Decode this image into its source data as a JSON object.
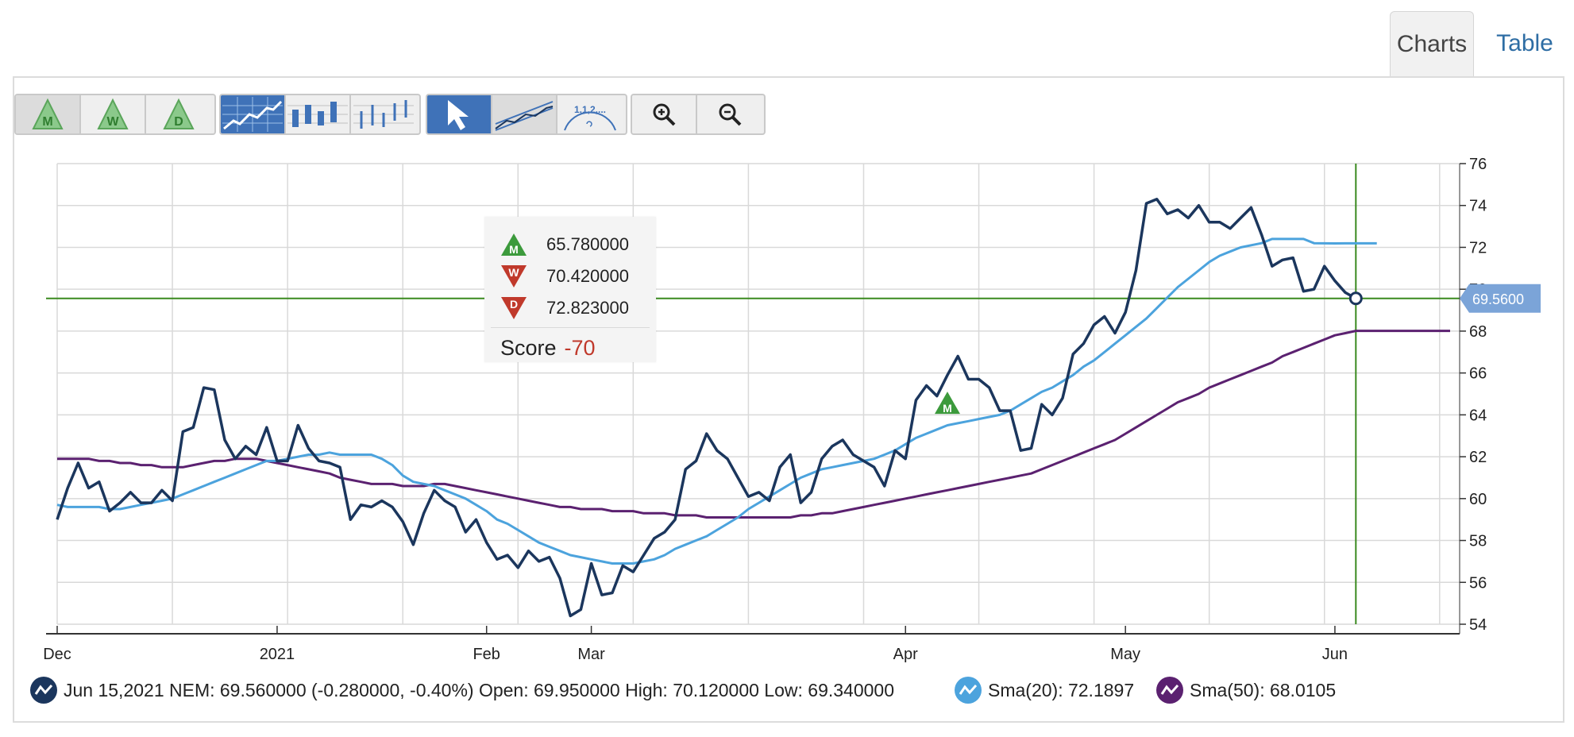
{
  "tabs": [
    {
      "label": "Charts",
      "active": true
    },
    {
      "label": "Table",
      "active": false
    }
  ],
  "toolbar": {
    "signal_buttons": [
      "M",
      "W",
      "D"
    ],
    "chart_type_buttons": [
      "line-chart-icon",
      "candlestick-chart-icon",
      "ohlc-chart-icon"
    ],
    "drawing_buttons": [
      "pointer-icon",
      "trend-channel-icon",
      "fibonacci-icon"
    ],
    "fibonacci_text": "1,1,2,...",
    "zoom_buttons": [
      "zoom-in-icon",
      "zoom-out-icon"
    ]
  },
  "tooltip": {
    "rows": [
      {
        "signal": "M",
        "direction": "up",
        "value": "65.780000"
      },
      {
        "signal": "W",
        "direction": "down",
        "value": "70.420000"
      },
      {
        "signal": "D",
        "direction": "down",
        "value": "72.823000"
      }
    ],
    "score_label": "Score",
    "score_value": "-70"
  },
  "legend": {
    "price_text": "Jun 15,2021 NEM: 69.560000 (-0.280000, -0.40%) Open: 69.950000 High: 70.120000 Low: 69.340000",
    "sma20_text": "Sma(20): 72.1897",
    "sma50_text": "Sma(50): 68.0105"
  },
  "colors": {
    "price": "#1b365d",
    "sma20": "#4ca3dd",
    "sma50": "#5b2170",
    "green_line": "#3a8a1f",
    "price_tag": "#7ba4d8",
    "signal_up": "#3c9a3c",
    "signal_down": "#c0392b"
  },
  "chart_data": {
    "type": "line",
    "ylim": [
      54,
      76
    ],
    "yticks": [
      54,
      56,
      58,
      60,
      62,
      64,
      66,
      68,
      70,
      72,
      74,
      76
    ],
    "xlim": [
      0,
      133
    ],
    "xticks": [
      {
        "x": 0,
        "label": "Dec"
      },
      {
        "x": 21,
        "label": "2021"
      },
      {
        "x": 41,
        "label": "Feb"
      },
      {
        "x": 51,
        "label": "Mar"
      },
      {
        "x": 81,
        "label": "Apr"
      },
      {
        "x": 102,
        "label": "May"
      },
      {
        "x": 122,
        "label": "Jun"
      }
    ],
    "current_value": 69.56,
    "current_value_label": "69.5600",
    "signal_marker": {
      "x": 85,
      "y": 64.5,
      "label": "M",
      "direction": "up"
    },
    "series": [
      {
        "name": "NEM",
        "values": [
          59.0,
          60.5,
          61.7,
          60.5,
          60.8,
          59.4,
          59.8,
          60.3,
          59.8,
          59.8,
          60.4,
          59.9,
          63.2,
          63.4,
          65.3,
          65.2,
          62.8,
          61.9,
          62.5,
          62.1,
          63.4,
          61.8,
          61.8,
          63.5,
          62.4,
          61.8,
          61.7,
          61.5,
          59.0,
          59.7,
          59.6,
          59.9,
          59.6,
          58.9,
          57.8,
          59.3,
          60.4,
          59.9,
          59.6,
          58.4,
          59.0,
          57.9,
          57.1,
          57.3,
          56.7,
          57.5,
          57.0,
          57.2,
          56.2,
          54.4,
          54.7,
          56.9,
          55.4,
          55.5,
          56.8,
          56.5,
          57.3,
          58.1,
          58.4,
          59.0,
          61.4,
          61.8,
          63.1,
          62.3,
          61.9,
          61.0,
          60.1,
          60.3,
          59.9,
          61.5,
          62.1,
          59.8,
          60.3,
          61.9,
          62.5,
          62.8,
          62.1,
          61.8,
          61.5,
          60.6,
          62.3,
          61.9,
          64.7,
          65.4,
          64.9,
          65.9,
          66.8,
          65.7,
          65.7,
          65.3,
          64.2,
          64.2,
          62.3,
          62.4,
          64.5,
          64.0,
          64.8,
          66.9,
          67.4,
          68.3,
          68.7,
          67.9,
          68.9,
          70.9,
          74.1,
          74.3,
          73.6,
          73.8,
          73.4,
          74.0,
          73.2,
          73.2,
          72.9,
          73.4,
          73.9,
          72.6,
          71.1,
          71.4,
          71.5,
          69.9,
          70.0,
          71.1,
          70.4,
          69.84,
          69.56
        ],
        "color": "#1b365d"
      },
      {
        "name": "Sma(20)",
        "values": [
          59.7,
          59.6,
          59.6,
          59.6,
          59.6,
          59.5,
          59.5,
          59.6,
          59.7,
          59.8,
          59.9,
          60.0,
          60.2,
          60.4,
          60.6,
          60.8,
          61.0,
          61.2,
          61.4,
          61.6,
          61.8,
          61.8,
          61.9,
          62.0,
          62.1,
          62.1,
          62.2,
          62.1,
          62.1,
          62.1,
          62.1,
          61.9,
          61.6,
          61.1,
          60.8,
          60.7,
          60.6,
          60.4,
          60.2,
          60.0,
          59.7,
          59.4,
          59.0,
          58.8,
          58.5,
          58.2,
          57.9,
          57.7,
          57.5,
          57.3,
          57.2,
          57.1,
          57.0,
          56.9,
          56.9,
          56.9,
          57.0,
          57.1,
          57.3,
          57.6,
          57.8,
          58.0,
          58.2,
          58.5,
          58.8,
          59.1,
          59.5,
          59.8,
          60.1,
          60.4,
          60.7,
          61.0,
          61.2,
          61.4,
          61.5,
          61.6,
          61.7,
          61.8,
          61.9,
          62.1,
          62.3,
          62.6,
          62.9,
          63.1,
          63.3,
          63.5,
          63.6,
          63.7,
          63.8,
          63.9,
          64.0,
          64.2,
          64.5,
          64.8,
          65.1,
          65.3,
          65.6,
          65.9,
          66.3,
          66.6,
          67.0,
          67.4,
          67.8,
          68.2,
          68.6,
          69.1,
          69.6,
          70.1,
          70.5,
          70.9,
          71.3,
          71.6,
          71.8,
          72.0,
          72.1,
          72.2,
          72.4,
          72.4,
          72.4,
          72.4,
          72.2,
          72.19,
          72.1897,
          72.19,
          72.19,
          72.19,
          72.19
        ],
        "color": "#4ca3dd"
      },
      {
        "name": "Sma(50)",
        "values": [
          61.9,
          61.9,
          61.9,
          61.9,
          61.8,
          61.8,
          61.7,
          61.7,
          61.6,
          61.6,
          61.5,
          61.5,
          61.5,
          61.6,
          61.7,
          61.8,
          61.8,
          61.9,
          61.9,
          61.9,
          61.8,
          61.7,
          61.6,
          61.5,
          61.4,
          61.3,
          61.2,
          61.0,
          60.9,
          60.8,
          60.7,
          60.7,
          60.7,
          60.6,
          60.6,
          60.6,
          60.7,
          60.7,
          60.6,
          60.5,
          60.4,
          60.3,
          60.2,
          60.1,
          60.0,
          59.9,
          59.8,
          59.7,
          59.6,
          59.6,
          59.5,
          59.5,
          59.5,
          59.4,
          59.4,
          59.4,
          59.3,
          59.3,
          59.3,
          59.2,
          59.2,
          59.2,
          59.1,
          59.1,
          59.1,
          59.1,
          59.1,
          59.1,
          59.1,
          59.1,
          59.1,
          59.2,
          59.2,
          59.3,
          59.3,
          59.4,
          59.5,
          59.6,
          59.7,
          59.8,
          59.9,
          60.0,
          60.1,
          60.2,
          60.3,
          60.4,
          60.5,
          60.6,
          60.7,
          60.8,
          60.9,
          61.0,
          61.1,
          61.2,
          61.4,
          61.6,
          61.8,
          62.0,
          62.2,
          62.4,
          62.6,
          62.8,
          63.1,
          63.4,
          63.7,
          64.0,
          64.3,
          64.6,
          64.8,
          65.0,
          65.3,
          65.5,
          65.7,
          65.9,
          66.1,
          66.3,
          66.5,
          66.8,
          67.0,
          67.2,
          67.4,
          67.6,
          67.8,
          67.9,
          68.0105,
          68.0105,
          68.0105,
          68.0105,
          68.0105,
          68.0105,
          68.0105,
          68.0105,
          68.0105,
          68.0105
        ],
        "color": "#5b2170"
      }
    ]
  }
}
